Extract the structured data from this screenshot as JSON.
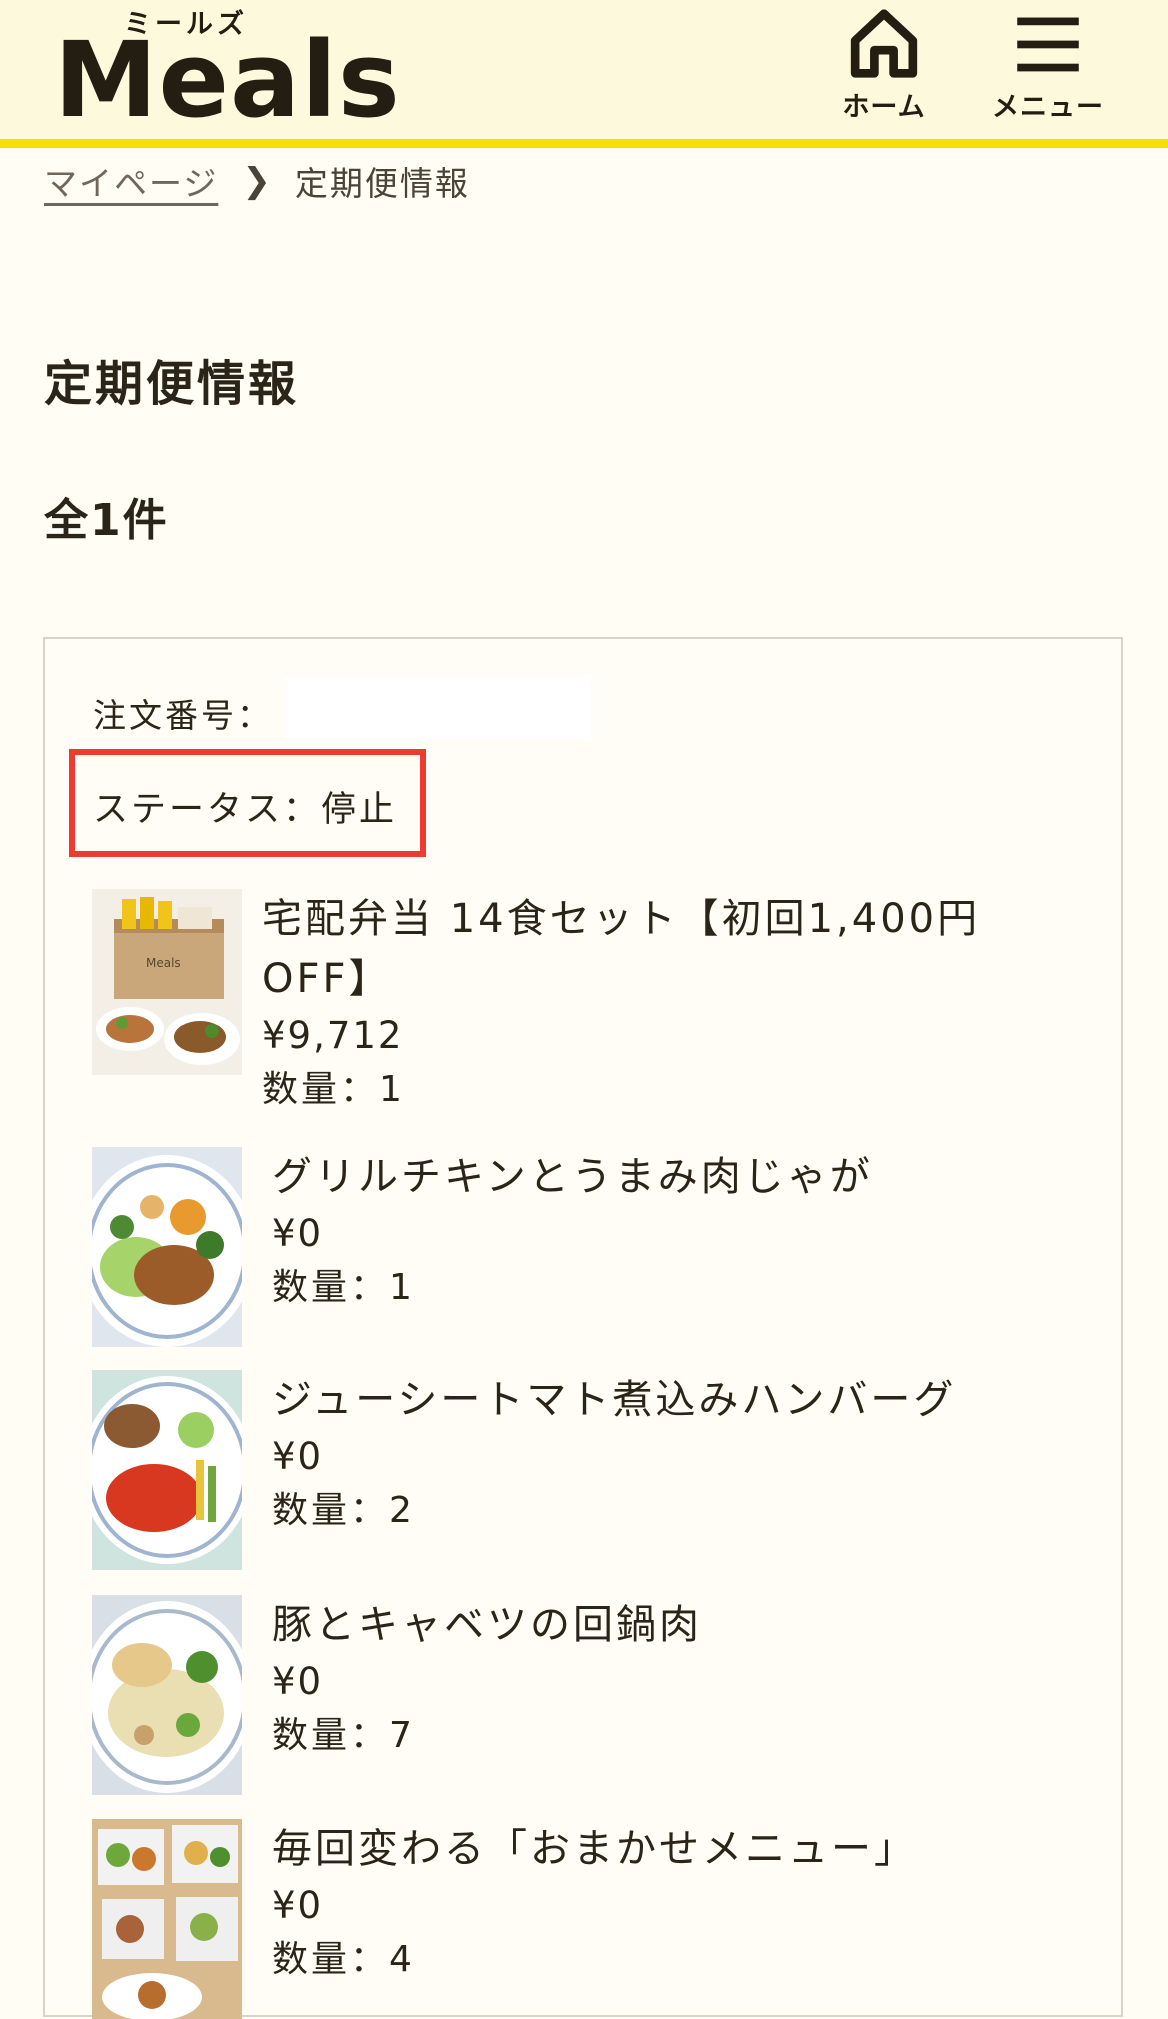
{
  "header": {
    "logo_kana": "ミールズ",
    "logo": "Meals",
    "home_label": "ホーム",
    "menu_label": "メニュー",
    "brand_color": "#f5e100"
  },
  "breadcrumb": {
    "parent": "マイページ",
    "current": "定期便情報"
  },
  "page": {
    "title": "定期便情報",
    "count": "全1件"
  },
  "order": {
    "number_label": "注文番号：",
    "status_label": "ステータス：停止"
  },
  "items": [
    {
      "name": "宅配弁当 14食セット【初回1,400円OFF】",
      "price": "¥9,712",
      "qty": "数量：1",
      "thumb": "meal-box-set"
    },
    {
      "name": "グリルチキンとうまみ肉じゃが",
      "price": "¥0",
      "qty": "数量：1",
      "thumb": "grilled-chicken-plate"
    },
    {
      "name": "ジューシートマト煮込みハンバーグ",
      "price": "¥0",
      "qty": "数量：2",
      "thumb": "tomato-hamburg-plate"
    },
    {
      "name": "豚とキャベツの回鍋肉",
      "price": "¥0",
      "qty": "数量：7",
      "thumb": "pork-cabbage-plate"
    },
    {
      "name": "毎回変わる「おまかせメニュー」",
      "price": "¥0",
      "qty": "数量：4",
      "thumb": "assorted-trays"
    }
  ]
}
